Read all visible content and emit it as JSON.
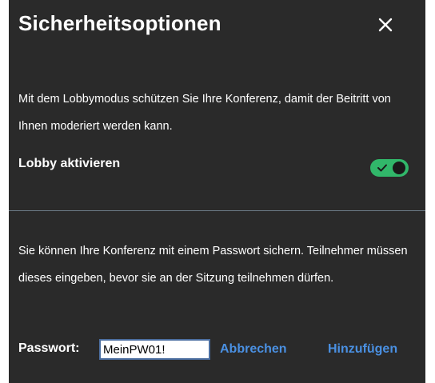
{
  "dialog": {
    "title": "Sicherheitsoptionen",
    "close_icon": "close-icon"
  },
  "lobby": {
    "description": "Mit dem Lobbymodus schützen Sie Ihre Konferenz, damit der Beitritt von Ihnen moderiert werden kann.",
    "toggle_label": "Lobby aktivieren",
    "toggle_on": true,
    "toggle_color": "#31b76a"
  },
  "password": {
    "description": "Sie können Ihre Konferenz mit einem Passwort sichern. Teilnehmer müssen dieses eingeben, bevor sie an der Sitzung teilnehmen dürfen.",
    "label": "Passwort:",
    "value": "MeinPW01!",
    "cancel_label": "Abbrechen",
    "add_label": "Hinzufügen",
    "link_color": "#4a90e2"
  }
}
